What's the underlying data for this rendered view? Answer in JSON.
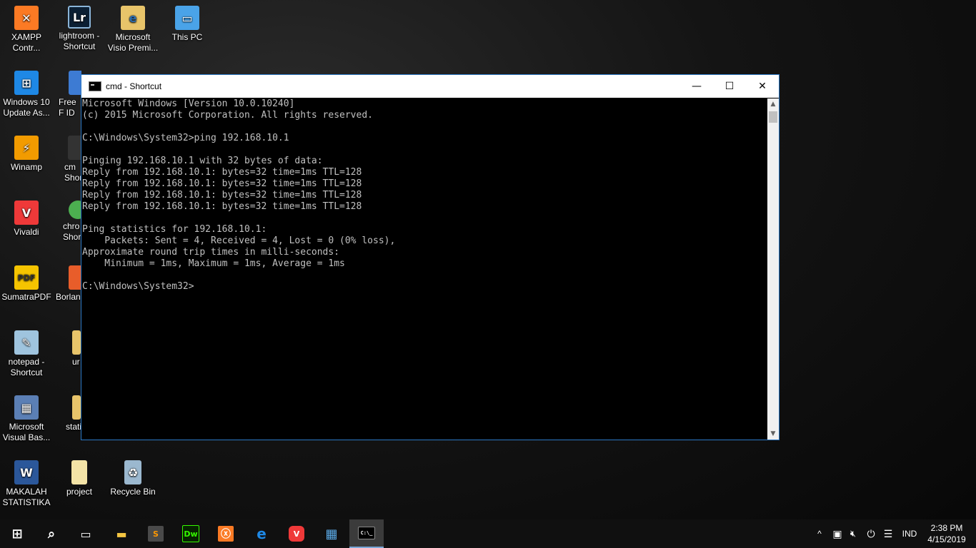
{
  "desktop": {
    "icons": [
      {
        "label": "XAMPP Contr...",
        "icon": "xampp-icon",
        "color": "#fb7a24"
      },
      {
        "label": "lightroom - Shortcut",
        "icon": "lightroom-icon",
        "color": "#0b1f33"
      },
      {
        "label": "Microsoft Visio Premi...",
        "icon": "visio-file-icon",
        "color": "#e8c46a"
      },
      {
        "label": "This PC",
        "icon": "computer-icon",
        "color": "#4aa3e8"
      },
      {
        "label": "Windows 10 Update As...",
        "icon": "windows-update-icon",
        "color": "#1e88e5"
      },
      {
        "label": "Free F ID",
        "icon": "free-app-icon",
        "color": "#3d7bd3"
      },
      {
        "label": "Winamp",
        "icon": "winamp-icon",
        "color": "#f29b00"
      },
      {
        "label": "cm Shor",
        "icon": "cmd-shortcut-icon",
        "color": "#333333"
      },
      {
        "label": "Vivaldi",
        "icon": "vivaldi-icon",
        "color": "#ef3939"
      },
      {
        "label": "chro Shor",
        "icon": "chrome-icon",
        "color": "#4caf50"
      },
      {
        "label": "SumatraPDF",
        "icon": "pdf-icon",
        "color": "#f5c400"
      },
      {
        "label": "Borlan",
        "icon": "borland-icon",
        "color": "#e85d2a"
      },
      {
        "label": "notepad - Shortcut",
        "icon": "notepad-icon",
        "color": "#9fc4de"
      },
      {
        "label": "ur",
        "icon": "folder-icon",
        "color": "#e8c46a"
      },
      {
        "label": "Microsoft Visual Bas...",
        "icon": "visual-basic-icon",
        "color": "#5b7fb5"
      },
      {
        "label": "stati",
        "icon": "folder-icon",
        "color": "#e8c46a"
      },
      {
        "label": "MAKALAH STATISTIKA",
        "icon": "word-doc-icon",
        "color": "#2b579a"
      },
      {
        "label": "project",
        "icon": "folder-icon",
        "color": "#f3e3a6"
      },
      {
        "label": "Recycle Bin",
        "icon": "recycle-bin-icon",
        "color": "#9bb8cf"
      }
    ]
  },
  "window": {
    "title": "cmd - Shortcut",
    "minimize_glyph": "—",
    "maximize_glyph": "☐",
    "close_glyph": "✕",
    "scroll_up_glyph": "▲",
    "scroll_down_glyph": "▼"
  },
  "console": {
    "lines": [
      "Microsoft Windows [Version 10.0.10240]",
      "(c) 2015 Microsoft Corporation. All rights reserved.",
      "",
      "C:\\Windows\\System32>ping 192.168.10.1",
      "",
      "Pinging 192.168.10.1 with 32 bytes of data:",
      "Reply from 192.168.10.1: bytes=32 time=1ms TTL=128",
      "Reply from 192.168.10.1: bytes=32 time=1ms TTL=128",
      "Reply from 192.168.10.1: bytes=32 time=1ms TTL=128",
      "Reply from 192.168.10.1: bytes=32 time=1ms TTL=128",
      "",
      "Ping statistics for 192.168.10.1:",
      "    Packets: Sent = 4, Received = 4, Lost = 0 (0% loss),",
      "Approximate round trip times in milli-seconds:",
      "    Minimum = 1ms, Maximum = 1ms, Average = 1ms",
      "",
      "C:\\Windows\\System32>"
    ]
  },
  "taskbar": {
    "items": [
      {
        "icon": "windows-start-icon",
        "glyph": "⊞",
        "color": "#ffffff"
      },
      {
        "icon": "search-icon",
        "glyph": "⌕",
        "color": "#ffffff"
      },
      {
        "icon": "task-view-icon",
        "glyph": "▭",
        "color": "#ffffff"
      },
      {
        "icon": "file-explorer-icon",
        "glyph": "▬",
        "color": "#f4c542"
      },
      {
        "icon": "sublime-text-icon",
        "glyph": "S",
        "color": "#ff9800"
      },
      {
        "icon": "dreamweaver-icon",
        "glyph": "Dw",
        "color": "#35fa00"
      },
      {
        "icon": "xampp-icon",
        "glyph": "ⓧ",
        "color": "#fb7a24"
      },
      {
        "icon": "edge-icon",
        "glyph": "e",
        "color": "#1e88e5"
      },
      {
        "icon": "vivaldi-icon",
        "glyph": "V",
        "color": "#ef3939"
      },
      {
        "icon": "control-panel-icon",
        "glyph": "▦",
        "color": "#5aa9e6"
      },
      {
        "icon": "cmd-icon",
        "glyph": "C:\\_",
        "color": "#ffffff"
      }
    ],
    "tray": {
      "chevron": "^",
      "language": "IND",
      "time": "2:38 PM",
      "date": "4/15/2019"
    }
  }
}
